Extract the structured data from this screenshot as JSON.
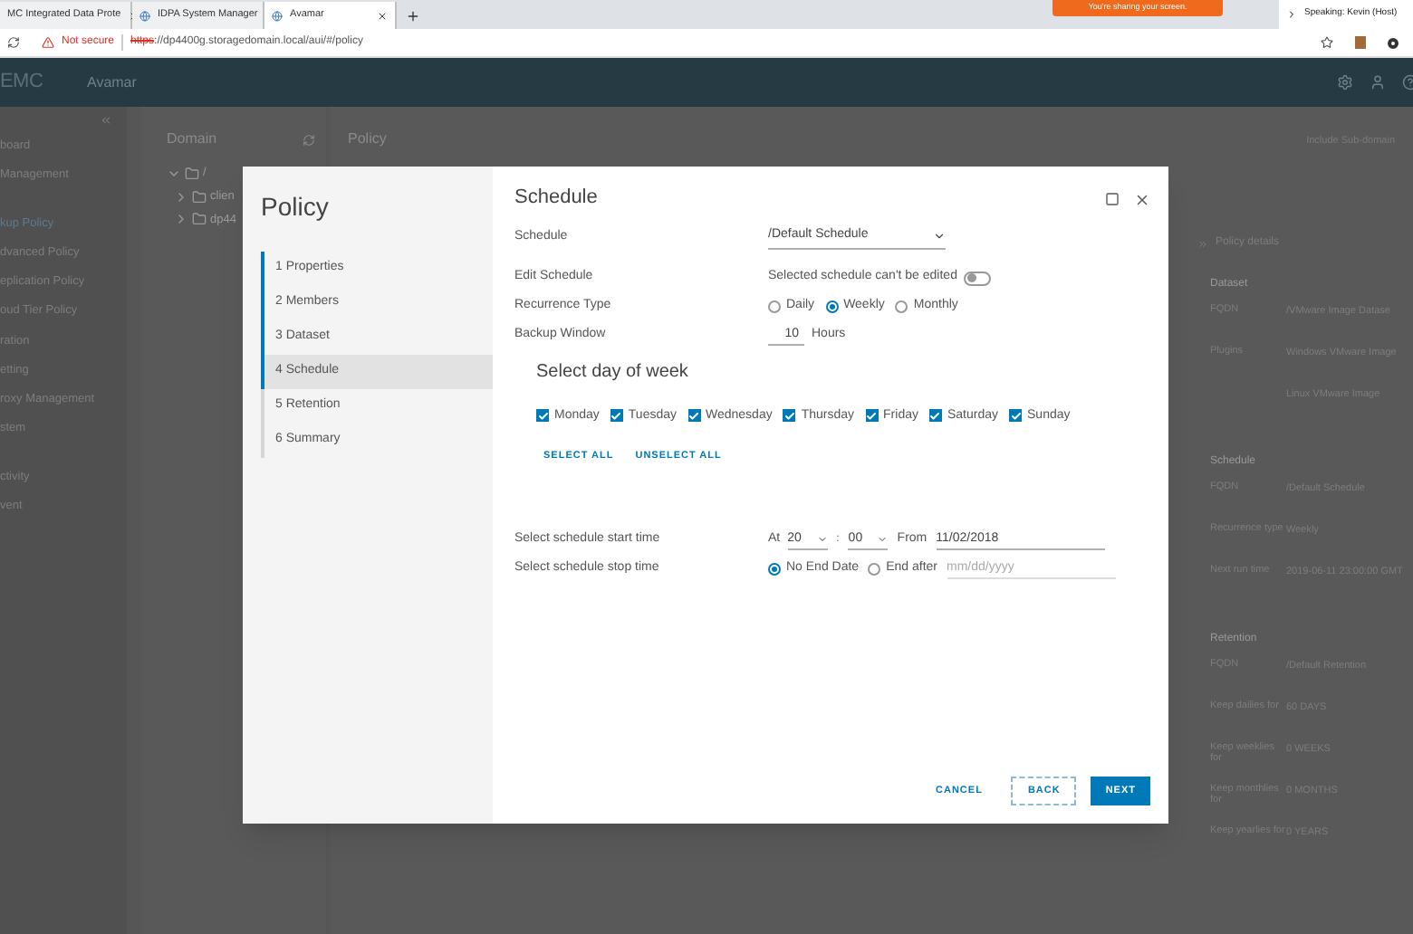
{
  "browser": {
    "tabs": [
      {
        "label": "MC Integrated Data Prote",
        "selected": false
      },
      {
        "label": "IDPA System Manager",
        "selected": false
      },
      {
        "label": "Avamar",
        "selected": true
      }
    ],
    "sharing_notice": "You're sharing your screen.",
    "speaker": "Speaking: Kevin (Host)",
    "security": "Not secure",
    "url_scheme": "https",
    "url_rest": "://dp4400g.storagedomain.local/aui/#/policy"
  },
  "app_header": {
    "logo": "EMC",
    "product": "Avamar"
  },
  "sidebar": {
    "items": [
      {
        "label": "board",
        "selected": false
      },
      {
        "label": "Management",
        "selected": false
      },
      {
        "label": "kup Policy",
        "selected": true
      },
      {
        "label": "dvanced Policy",
        "selected": false
      },
      {
        "label": "eplication Policy",
        "selected": false
      },
      {
        "label": "oud Tier Policy",
        "selected": false
      },
      {
        "label": "ration",
        "selected": false
      },
      {
        "label": "etting",
        "selected": false
      },
      {
        "label": "roxy Management",
        "selected": false
      },
      {
        "label": "stem",
        "selected": false
      },
      {
        "label": "ctivity",
        "selected": false
      },
      {
        "label": "vent",
        "selected": false
      }
    ]
  },
  "domain_panel": {
    "title": "Domain",
    "tree": [
      {
        "label": "/",
        "expanded": true,
        "children": [
          {
            "label": "clien",
            "expanded": false
          },
          {
            "label": "dp44",
            "expanded": false
          }
        ]
      }
    ]
  },
  "policy_panel": {
    "title": "Policy",
    "option": "Include Sub-domain"
  },
  "details_panel": {
    "title": "Policy details",
    "sections": [
      {
        "title": "Dataset",
        "rows": [
          {
            "label": "FQDN",
            "value": "/VMware Image Datase"
          },
          {
            "label": "Plugins",
            "value": "Windows VMware Image"
          },
          {
            "label": "",
            "value": "Linux VMware Image"
          }
        ]
      },
      {
        "title": "Schedule",
        "rows": [
          {
            "label": "FQDN",
            "value": "/Default Schedule"
          },
          {
            "label": "Recurrence type",
            "value": "Weekly"
          },
          {
            "label": "Next run time",
            "value": "2019-06-11 23:00:00 GMT"
          }
        ]
      },
      {
        "title": "Retention",
        "rows": [
          {
            "label": "FQDN",
            "value": "/Default Retention"
          },
          {
            "label": "Keep dailies for",
            "value": "60 DAYS"
          },
          {
            "label": "Keep weeklies for",
            "value": "0 WEEKS"
          },
          {
            "label": "Keep monthlies for",
            "value": "0 MONTHS"
          },
          {
            "label": "Keep yearlies for",
            "value": "0 YEARS"
          }
        ]
      }
    ]
  },
  "dialog": {
    "title": "Policy",
    "steps": [
      {
        "label": "1 Properties",
        "selected": false,
        "completed": true
      },
      {
        "label": "2 Members",
        "selected": false,
        "completed": true
      },
      {
        "label": "3 Dataset",
        "selected": false,
        "completed": true
      },
      {
        "label": "4 Schedule",
        "selected": true,
        "completed": true
      },
      {
        "label": "5 Retention",
        "selected": false,
        "completed": false
      },
      {
        "label": "6 Summary",
        "selected": false,
        "completed": false
      }
    ],
    "section_title": "Schedule",
    "fields": [
      {
        "kind": "select",
        "label": "Schedule",
        "value": "/Default Schedule"
      },
      {
        "kind": "toggle",
        "label": "Edit Schedule",
        "text": "Selected schedule can't be edited",
        "on": false
      },
      {
        "kind": "radio",
        "label": "Recurrence Type",
        "options": [
          {
            "label": "Daily",
            "selected": false
          },
          {
            "label": "Weekly",
            "selected": true
          },
          {
            "label": "Monthly",
            "selected": false
          }
        ]
      },
      {
        "kind": "number",
        "label": "Backup Window",
        "value": "10",
        "unit": "Hours"
      }
    ],
    "days_title": "Select day of week",
    "days": [
      {
        "label": "Monday",
        "checked": true
      },
      {
        "label": "Tuesday",
        "checked": true
      },
      {
        "label": "Wednesday",
        "checked": true
      },
      {
        "label": "Thursday",
        "checked": true
      },
      {
        "label": "Friday",
        "checked": true
      },
      {
        "label": "Saturday",
        "checked": true
      },
      {
        "label": "Sunday",
        "checked": true
      }
    ],
    "select_all": "SELECT ALL",
    "unselect_all": "UNSELECT ALL",
    "start_time": {
      "label": "Select schedule start time",
      "at_label": "At",
      "hour": "20",
      "separator": ":",
      "minute": "00",
      "from_label": "From",
      "date": "11/02/2018"
    },
    "stop_time": {
      "label": "Select schedule stop time",
      "options": [
        {
          "label": "No End Date",
          "selected": true
        },
        {
          "label": "End after",
          "selected": false
        }
      ],
      "date_placeholder": "mm/dd/yyyy"
    },
    "buttons": [
      {
        "label": "CANCEL",
        "kind": "text"
      },
      {
        "label": "BACK",
        "kind": "outline"
      },
      {
        "label": "NEXT",
        "kind": "primary"
      }
    ]
  }
}
